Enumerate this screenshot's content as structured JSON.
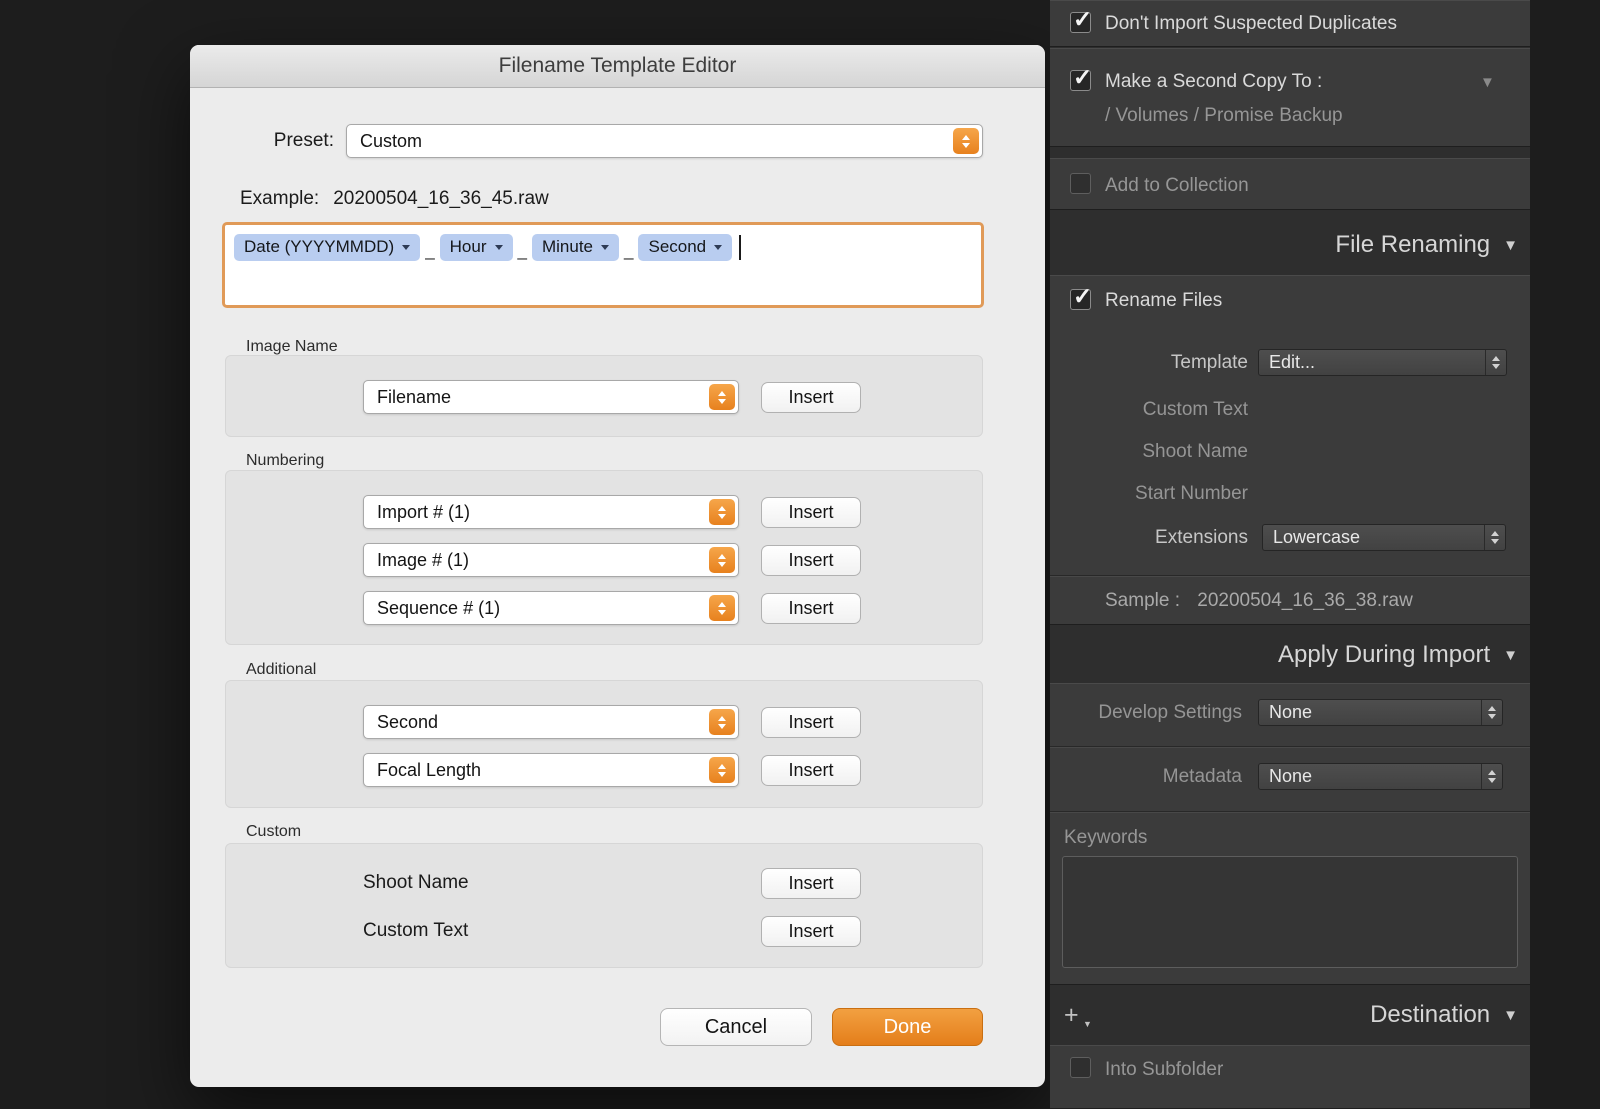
{
  "icons": {
    "check": "✓",
    "triangle_down": "▼",
    "plus": "+"
  },
  "dialog": {
    "title": "Filename Template Editor",
    "preset": {
      "label": "Preset:",
      "value": "Custom"
    },
    "example": {
      "label": "Example:",
      "value": "20200504_16_36_45.raw"
    },
    "tokens": {
      "separator": "_",
      "items": [
        {
          "label": "Date (YYYYMMDD)"
        },
        {
          "label": "Hour"
        },
        {
          "label": "Minute"
        },
        {
          "label": "Second"
        }
      ]
    },
    "insert_label": "Insert",
    "sections": {
      "image_name": {
        "label": "Image Name",
        "select": "Filename"
      },
      "numbering": {
        "label": "Numbering",
        "selects": [
          "Import # (1)",
          "Image # (1)",
          "Sequence # (1)"
        ]
      },
      "additional": {
        "label": "Additional",
        "selects": [
          "Second",
          "Focal Length"
        ]
      },
      "custom": {
        "label": "Custom",
        "rows": [
          "Shoot Name",
          "Custom Text"
        ]
      }
    },
    "buttons": {
      "cancel": "Cancel",
      "done": "Done"
    }
  },
  "panel": {
    "duplicates": {
      "label": "Don't Import Suspected Duplicates",
      "checked": true
    },
    "second_copy": {
      "label": "Make a Second Copy To :",
      "path": "/ Volumes / Promise Backup",
      "checked": true
    },
    "add_to_collection": {
      "label": "Add to Collection",
      "checked": false
    },
    "file_renaming": {
      "header": "File Renaming",
      "rename_files": "Rename Files",
      "template": {
        "label": "Template",
        "value": "Edit..."
      },
      "custom_text": "Custom Text",
      "shoot_name": "Shoot Name",
      "start_number": "Start Number",
      "extensions": {
        "label": "Extensions",
        "value": "Lowercase"
      },
      "sample": {
        "label": "Sample :",
        "value": "20200504_16_36_38.raw"
      }
    },
    "apply_during_import": {
      "header": "Apply During Import",
      "develop_settings": {
        "label": "Develop Settings",
        "value": "None"
      },
      "metadata": {
        "label": "Metadata",
        "value": "None"
      },
      "keywords_label": "Keywords"
    },
    "destination": {
      "header": "Destination",
      "into_subfolder": "Into Subfolder"
    }
  }
}
